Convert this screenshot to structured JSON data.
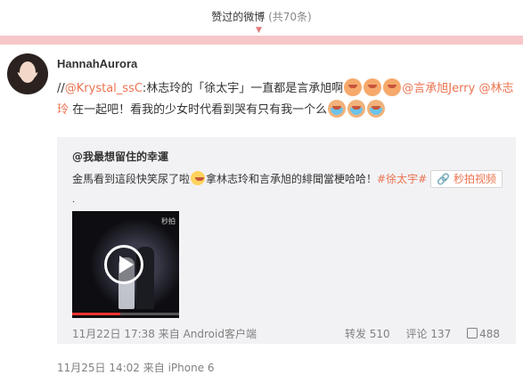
{
  "header": {
    "title": "赞过的微博",
    "count": "(共70条)"
  },
  "post": {
    "username": "HannahAurora",
    "text_prefix": "//",
    "mention1": "@Krystal_ssC",
    "text_a": ":林志玲的「徐太宇」一直都是言承旭啊",
    "mention2": "@言承旭Jerry",
    "space": " ",
    "mention3": "@林志玲",
    "text_b": " 在一起吧！看我的少女时代看到哭有只有我一个么",
    "footer": "11月25日 14:02 来自 iPhone 6"
  },
  "repost": {
    "username": "@我最想留住的幸運",
    "text_a": "金馬看到這段快笑尿了啦",
    "text_b": "拿林志玲和言承旭的緋聞當梗哈哈！",
    "hashtag": "#徐太宇#",
    "video_label": "秒拍视频",
    "dot": ".",
    "video_logo": "秒拍",
    "video_progress": 0.45,
    "footer": "11月22日 17:38 来自 Android客户端",
    "stats": {
      "repost": "转发 510",
      "comment": "评论 137",
      "like": "488"
    }
  },
  "colors": {
    "accent": "#eb7350",
    "pinkbar": "#f7c6c8"
  }
}
